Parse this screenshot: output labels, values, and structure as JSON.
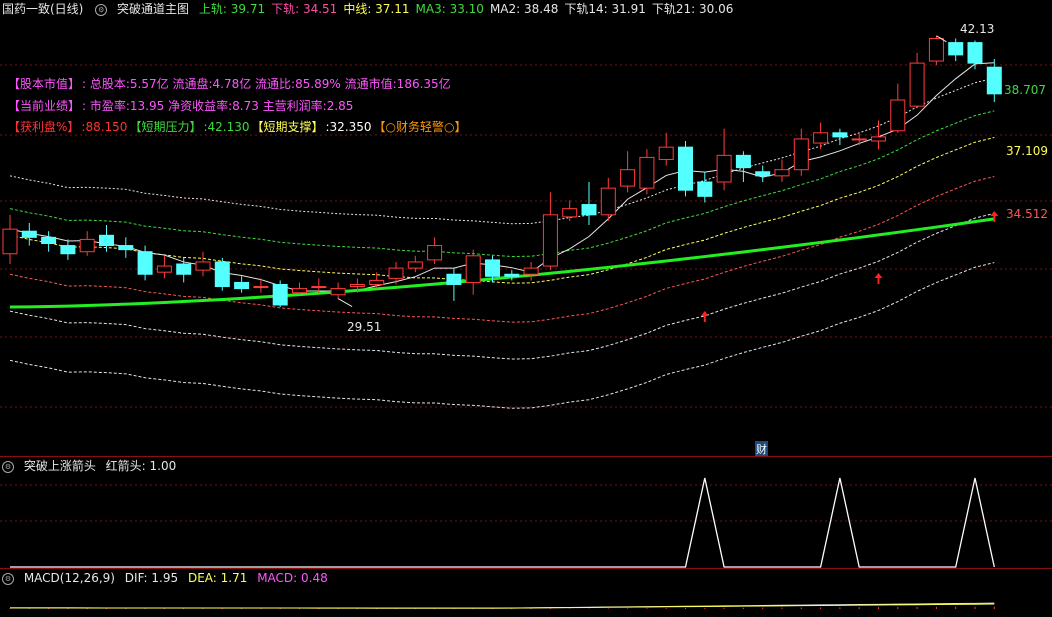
{
  "main_header": {
    "security": "国药一致(日线)",
    "indicator": "突破通道主图",
    "items": [
      {
        "label": "上轨",
        "value": "39.71",
        "color": "#3cdc3c"
      },
      {
        "label": "下轨",
        "value": "34.51",
        "color": "#ff4da6"
      },
      {
        "label": "中线",
        "value": "37.11",
        "color": "#ffff55"
      },
      {
        "label": "MA3",
        "value": "33.10",
        "color": "#3cdc3c"
      },
      {
        "label": "MA2",
        "value": "38.48",
        "color": "#e6e6e6"
      },
      {
        "label": "下轨14",
        "value": "31.91",
        "color": "#e6e6e6"
      },
      {
        "label": "下轨21",
        "value": "30.06",
        "color": "#e6e6e6"
      }
    ]
  },
  "info": {
    "line1": {
      "tag": "【股本市值】",
      "text": ": 总股本:5.57亿 流通盘:4.78亿 流通比:85.89% 流通市值:186.35亿"
    },
    "line2": {
      "tag": "【当前业绩】",
      "text": ": 市盈率:13.95 净资收益率:8.73 主营利润率:2.85"
    },
    "line3": {
      "tag1": "【获利盘%】",
      "val1": ":88.150",
      "tag2": "【短期压力】",
      "val2": ":42.130",
      "tag3": "【短期支撑】",
      "val3": ":32.350",
      "tag4": "【○财务轻警○】"
    }
  },
  "price_labels": {
    "high": "42.13",
    "low": "29.51",
    "upper_right": "38.707",
    "mid_right": "37.109",
    "lower_right": "34.512",
    "finance_marker": "财"
  },
  "arrow_pane": {
    "title": "突破上涨箭头",
    "series_label": "红箭头: 1.00"
  },
  "macd_pane": {
    "title": "MACD(12,26,9)",
    "dif": "DIF: 1.95",
    "dea": "DEA: 1.71",
    "macd": "MACD: 0.48"
  },
  "chart_data": {
    "type": "candlestick",
    "candles": [
      [
        31.5,
        32.7,
        33.4,
        31.0
      ],
      [
        32.6,
        32.3,
        33.0,
        31.9
      ],
      [
        32.3,
        32.0,
        32.6,
        31.6
      ],
      [
        31.9,
        31.5,
        32.2,
        31.2
      ],
      [
        31.6,
        32.2,
        32.6,
        31.4
      ],
      [
        32.4,
        31.9,
        32.9,
        31.6
      ],
      [
        31.9,
        31.7,
        32.3,
        31.3
      ],
      [
        31.6,
        30.5,
        31.9,
        30.2
      ],
      [
        30.6,
        30.9,
        31.4,
        30.3
      ],
      [
        31.0,
        30.5,
        31.3,
        30.1
      ],
      [
        30.7,
        31.1,
        31.6,
        30.4
      ],
      [
        31.1,
        29.9,
        31.3,
        29.7
      ],
      [
        30.1,
        29.8,
        30.4,
        29.6
      ],
      [
        29.9,
        29.9,
        30.3,
        29.6
      ],
      [
        30.0,
        29.0,
        30.2,
        28.9
      ],
      [
        29.6,
        29.8,
        30.1,
        29.5
      ],
      [
        29.9,
        29.9,
        30.3,
        29.6
      ],
      [
        29.5,
        29.8,
        30.1,
        29.3
      ],
      [
        29.9,
        30.0,
        30.3,
        29.6
      ],
      [
        30.0,
        30.2,
        30.6,
        29.8
      ],
      [
        30.3,
        30.8,
        31.1,
        30.0
      ],
      [
        30.8,
        31.1,
        31.4,
        30.6
      ],
      [
        31.2,
        31.9,
        32.3,
        31.0
      ],
      [
        30.5,
        30.0,
        30.8,
        29.2
      ],
      [
        30.1,
        31.4,
        31.7,
        29.5
      ],
      [
        31.2,
        30.4,
        31.4,
        30.1
      ],
      [
        30.5,
        30.4,
        30.7,
        30.2
      ],
      [
        30.5,
        30.8,
        31.1,
        30.2
      ],
      [
        30.9,
        33.4,
        34.5,
        30.7
      ],
      [
        33.3,
        33.7,
        34.1,
        33.1
      ],
      [
        33.9,
        33.4,
        35.0,
        32.9
      ],
      [
        33.4,
        34.7,
        35.2,
        33.1
      ],
      [
        34.8,
        35.6,
        36.5,
        34.5
      ],
      [
        34.7,
        36.2,
        36.6,
        34.4
      ],
      [
        36.1,
        36.7,
        37.4,
        35.8
      ],
      [
        36.7,
        34.6,
        37.0,
        34.3
      ],
      [
        35.0,
        34.3,
        35.5,
        34.0
      ],
      [
        35.0,
        36.3,
        37.6,
        34.6
      ],
      [
        36.3,
        35.7,
        36.5,
        35.0
      ],
      [
        35.5,
        35.3,
        35.8,
        35.0
      ],
      [
        35.3,
        35.6,
        36.1,
        35.0
      ],
      [
        35.6,
        37.1,
        37.6,
        35.3
      ],
      [
        36.9,
        37.4,
        37.9,
        36.6
      ],
      [
        37.4,
        37.2,
        37.6,
        36.8
      ],
      [
        37.1,
        37.1,
        37.4,
        36.8
      ],
      [
        37.0,
        37.2,
        38.0,
        36.6
      ],
      [
        37.5,
        39.0,
        39.8,
        37.4
      ],
      [
        38.7,
        40.8,
        41.3,
        38.6
      ],
      [
        40.9,
        42.0,
        42.13,
        40.7
      ],
      [
        41.8,
        41.2,
        42.0,
        40.9
      ],
      [
        41.8,
        40.8,
        41.9,
        40.5
      ],
      [
        40.6,
        39.3,
        41.0,
        38.9
      ]
    ],
    "markers": {
      "high_value": 42.13,
      "low_value": 29.51
    },
    "arrow_signal": [
      0,
      0,
      0,
      0,
      0,
      0,
      0,
      0,
      0,
      0,
      0,
      0,
      0,
      0,
      0,
      0,
      0,
      0,
      0,
      0,
      0,
      0,
      0,
      0,
      0,
      0,
      0,
      0,
      0,
      0,
      0,
      0,
      0,
      0,
      0,
      0,
      1,
      0,
      0,
      0,
      0,
      0,
      0,
      1,
      0,
      0,
      0,
      0,
      0,
      0,
      1,
      0
    ],
    "macd": {
      "dif": 1.95,
      "dea": 1.71,
      "macd": 0.48
    }
  }
}
